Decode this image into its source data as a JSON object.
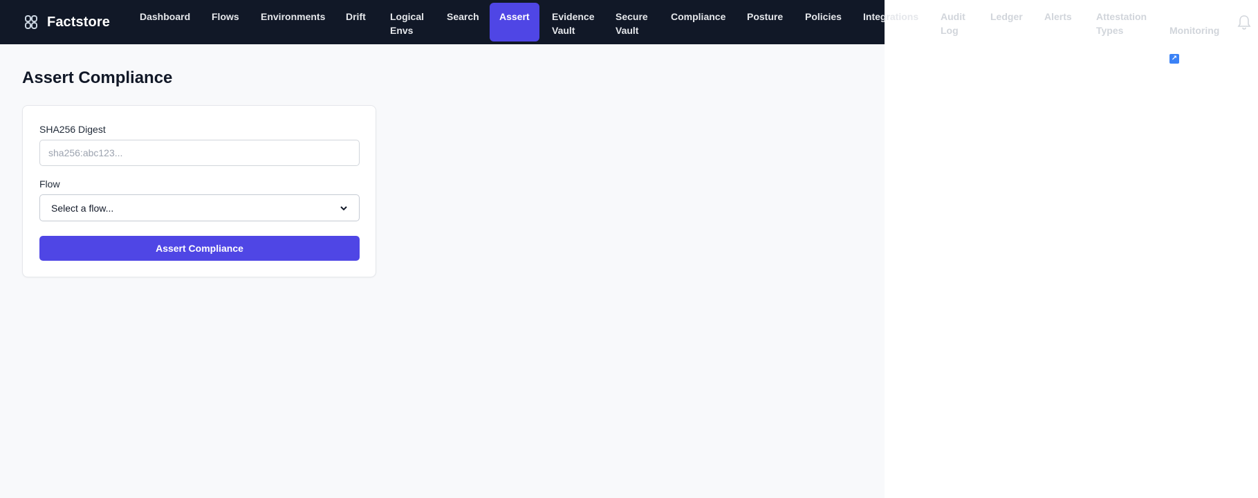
{
  "brand": {
    "name": "Factstore",
    "icon": "chain-link-icon"
  },
  "nav": {
    "items": [
      {
        "label": "Dashboard"
      },
      {
        "label": "Flows"
      },
      {
        "label": "Environments"
      },
      {
        "label": "Drift"
      },
      {
        "label": "Logical\nEnvs"
      },
      {
        "label": "Search"
      },
      {
        "label": "Assert"
      },
      {
        "label": "Evidence\nVault"
      },
      {
        "label": "Secure\nVault"
      },
      {
        "label": "Compliance"
      },
      {
        "label": "Posture"
      },
      {
        "label": "Policies"
      },
      {
        "label": "Integrations"
      },
      {
        "label": "Audit\nLog"
      },
      {
        "label": "Ledger"
      },
      {
        "label": "Alerts"
      },
      {
        "label": "Attestation\nTypes"
      },
      {
        "label": "Monitoring"
      }
    ],
    "active": "Assert",
    "external_icon": "external-link-icon"
  },
  "notifications": {
    "icon": "bell-icon"
  },
  "page": {
    "title": "Assert Compliance"
  },
  "form": {
    "digest_label": "SHA256 Digest",
    "digest_placeholder": "sha256:abc123...",
    "digest_value": "",
    "flow_label": "Flow",
    "flow_selected": "Select a flow...",
    "submit_label": "Assert Compliance"
  },
  "colors": {
    "topbar": "#111827",
    "accent": "#4f46e5",
    "page_bg": "#f8f9fb"
  }
}
